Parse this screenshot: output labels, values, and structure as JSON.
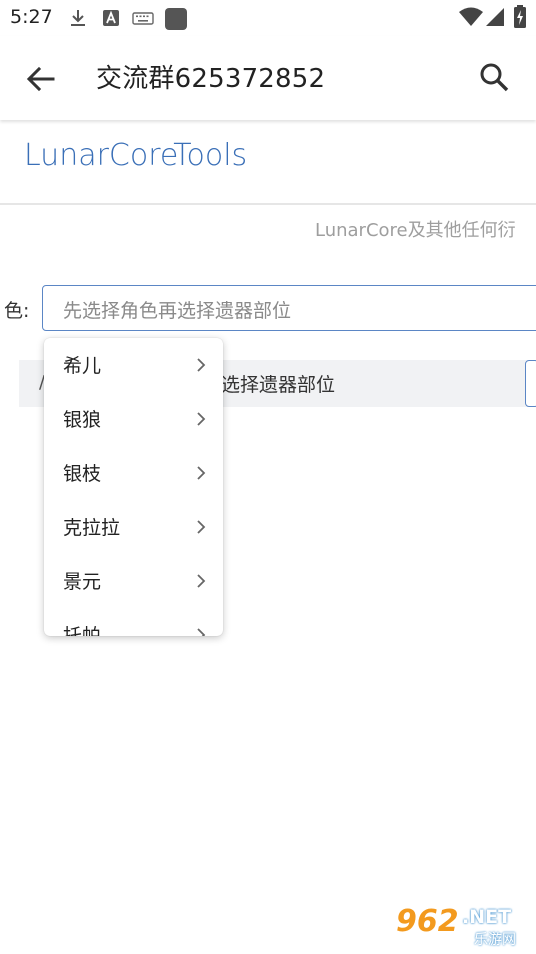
{
  "status_bar": {
    "time": "5:27",
    "icons": [
      "download-icon",
      "a-badge-icon",
      "keyboard-icon",
      "app-square-icon",
      "wifi-icon",
      "signal-icon",
      "battery-charging-icon"
    ]
  },
  "app_bar": {
    "title": "交流群625372852",
    "back_icon": "arrow-left-icon",
    "search_icon": "search-icon"
  },
  "tools": {
    "title": "LunarCoreTools",
    "notice": "LunarCore及其他任何衍"
  },
  "role_selector": {
    "label": "色:",
    "placeholder": "先选择角色再选择遗器部位"
  },
  "relic_row": {
    "fragment": "/",
    "hint": "选择遗器部位"
  },
  "dropdown": {
    "items": [
      {
        "label": "希儿"
      },
      {
        "label": "银狼"
      },
      {
        "label": "银枝"
      },
      {
        "label": "克拉拉"
      },
      {
        "label": "景元"
      },
      {
        "label": "托帕"
      }
    ]
  },
  "watermark": {
    "number": "962",
    "suffix": ".NET",
    "sub": "乐游网"
  },
  "colors": {
    "accent": "#3a6fb7",
    "input_border": "#5b86c5",
    "watermark_orange": "#f39a1e"
  }
}
